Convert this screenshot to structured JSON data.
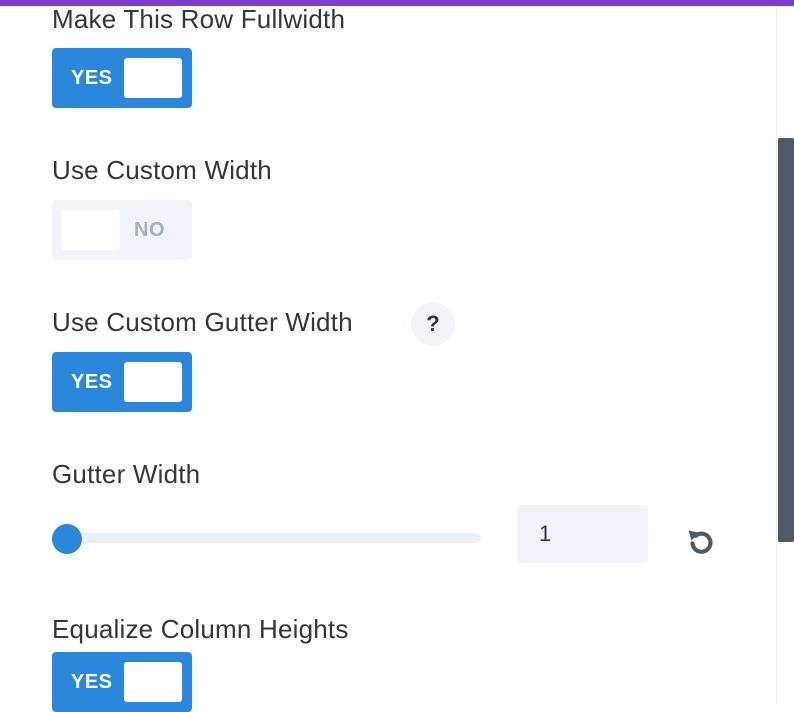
{
  "settings": {
    "fullwidth": {
      "label": "Make This Row Fullwidth",
      "state": "YES"
    },
    "custom_width": {
      "label": "Use Custom Width",
      "state": "NO"
    },
    "custom_gutter": {
      "label": "Use Custom Gutter Width",
      "help": "?",
      "state": "YES"
    },
    "gutter_width": {
      "label": "Gutter Width",
      "value": "1",
      "slider_fraction": 0.0
    },
    "equalize_heights": {
      "label": "Equalize Column Heights",
      "state": "YES"
    }
  },
  "icons": {
    "reset": "undo-icon",
    "help": "question-icon"
  },
  "colors": {
    "accent": "#2b87da",
    "top_bar": "#7e3bd0",
    "toggle_off_bg": "#f1f5f9",
    "text": "#32373c",
    "scrollbar": "#4e5a67"
  }
}
